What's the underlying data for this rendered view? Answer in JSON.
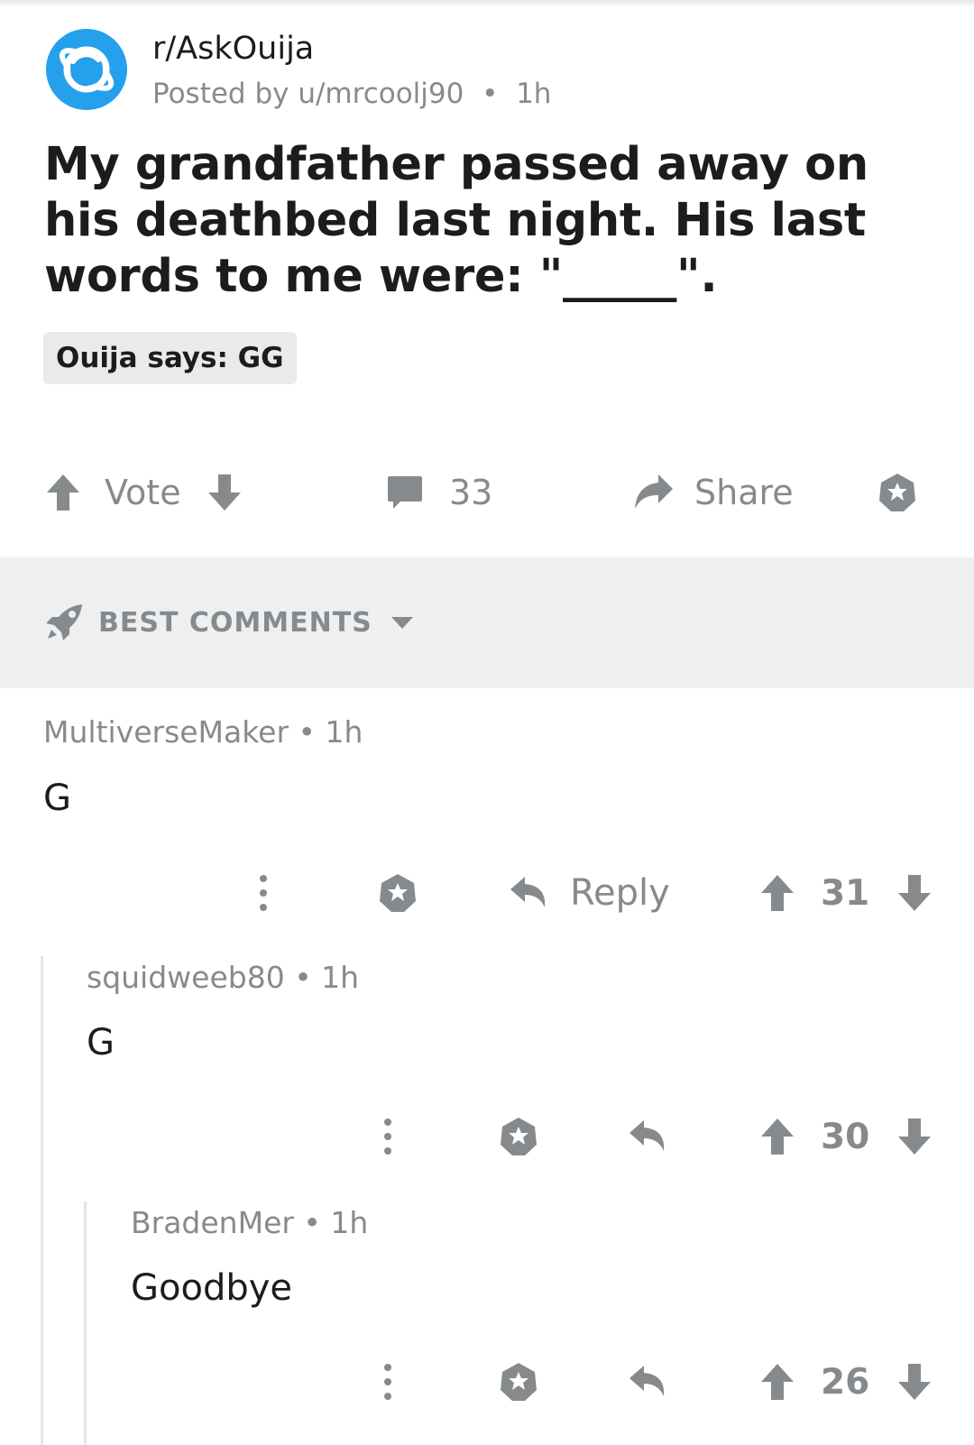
{
  "post": {
    "subreddit": "r/AskOuija",
    "posted_by": "Posted by u/mrcoolj90",
    "age": "1h",
    "title": "My grandfather passed away on his deathbed last night. His last words to me were: \"_____\".",
    "flair": "Ouija says: GG",
    "vote_label": "Vote",
    "comment_count": "33",
    "share_label": "Share"
  },
  "sort": {
    "label": "BEST COMMENTS"
  },
  "comments": [
    {
      "author": "MultiverseMaker",
      "age": "1h",
      "body": "G",
      "reply_label": "Reply",
      "score": "31"
    },
    {
      "author": "squidweeb80",
      "age": "1h",
      "body": "G",
      "score": "30"
    },
    {
      "author": "BradenMer",
      "age": "1h",
      "body": "Goodbye",
      "score": "26"
    }
  ],
  "colors": {
    "accent": "#24a0ed",
    "muted": "#878a8c",
    "sort_bg": "#edeff1"
  }
}
